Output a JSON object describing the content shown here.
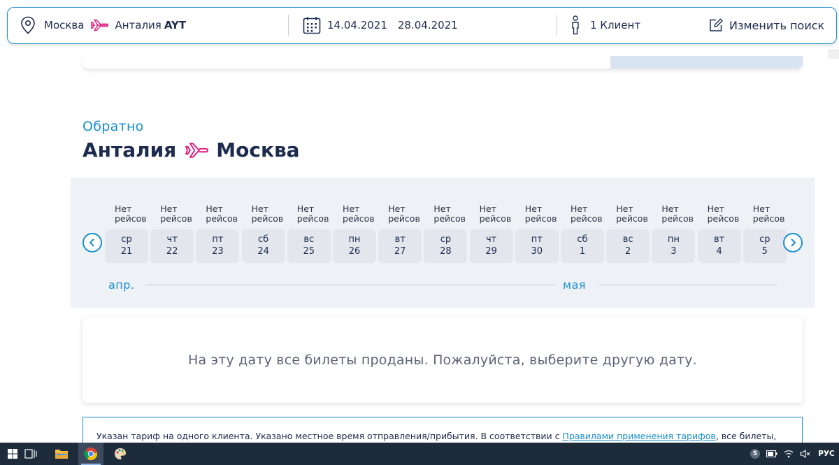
{
  "search": {
    "from": "Москва",
    "to": "Анталия",
    "to_code": "AYT",
    "date_depart": "14.04.2021",
    "date_return": "28.04.2021",
    "clients": "1 Клиент",
    "edit_label": "Изменить поиск"
  },
  "section": {
    "label": "Обратно",
    "route_from": "Анталия",
    "route_to": "Москва"
  },
  "calendar": {
    "days": [
      {
        "status": "Нет рейсов",
        "weekday": "ср",
        "day": "21"
      },
      {
        "status": "Нет рейсов",
        "weekday": "чт",
        "day": "22"
      },
      {
        "status": "Нет рейсов",
        "weekday": "пт",
        "day": "23"
      },
      {
        "status": "Нет рейсов",
        "weekday": "сб",
        "day": "24"
      },
      {
        "status": "Нет рейсов",
        "weekday": "вс",
        "day": "25"
      },
      {
        "status": "Нет рейсов",
        "weekday": "пн",
        "day": "26"
      },
      {
        "status": "Нет рейсов",
        "weekday": "вт",
        "day": "27"
      },
      {
        "status": "Нет рейсов",
        "weekday": "ср",
        "day": "28"
      },
      {
        "status": "Нет рейсов",
        "weekday": "чт",
        "day": "29"
      },
      {
        "status": "Нет рейсов",
        "weekday": "пт",
        "day": "30"
      },
      {
        "status": "Нет рейсов",
        "weekday": "сб",
        "day": "1"
      },
      {
        "status": "Нет рейсов",
        "weekday": "вс",
        "day": "2"
      },
      {
        "status": "Нет рейсов",
        "weekday": "пн",
        "day": "3"
      },
      {
        "status": "Нет рейсов",
        "weekday": "вт",
        "day": "4"
      },
      {
        "status": "Нет рейсов",
        "weekday": "ср",
        "day": "5"
      }
    ],
    "month_1": "апр.",
    "month_2": "мая"
  },
  "message": "На эту дату все билеты проданы. Пожалуйста, выберите другую дату.",
  "info": {
    "text_before": "Указан тариф на одного клиента. Указано местное время отправления/прибытия. В соответствии с ",
    "link": "Правилами применения тарифов",
    "text_after": ", все билеты,"
  },
  "taskbar": {
    "language": "РУС",
    "skype_letter": "S"
  },
  "colors": {
    "accent": "#1a8fd0",
    "navy": "#1d2b4f",
    "plane_pink": "#e0197d",
    "calendar_bg": "#eef1f5"
  }
}
